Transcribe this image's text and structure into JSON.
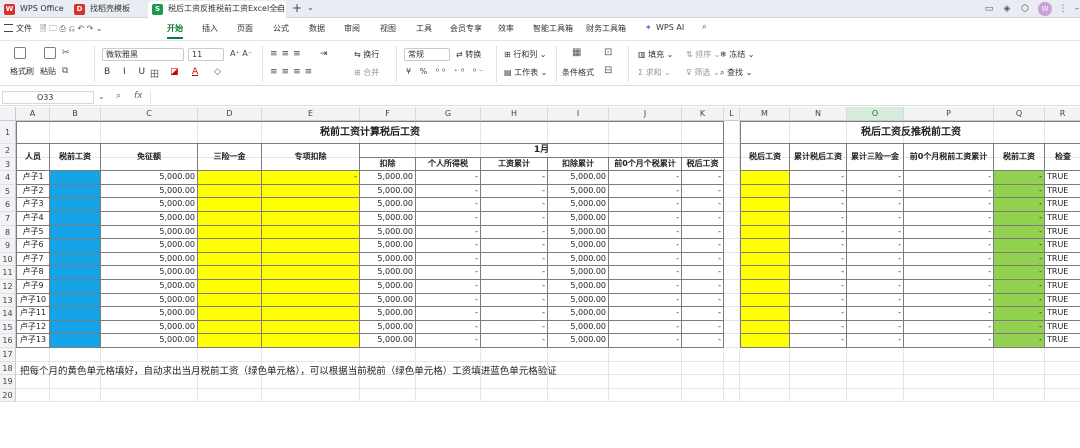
{
  "tabs": [
    {
      "label": "WPS Office",
      "icon": "wps-logo-icon",
      "color": "#d9312b"
    },
    {
      "label": "找稻壳模板",
      "icon": "daoke-template-icon",
      "color": "#d9312b"
    },
    {
      "label": "税后工资反推税前工资Excel全自",
      "icon": "spreadsheet-icon",
      "color": "#1a9b4b"
    }
  ],
  "menus": [
    "文件",
    "开始",
    "插入",
    "页面",
    "公式",
    "数据",
    "审阅",
    "视图",
    "工具",
    "会员专享",
    "效率",
    "智能工具箱",
    "财务工具箱",
    "WPS AI"
  ],
  "active_menu": "开始",
  "toolbar": {
    "format_painter": "格式刷",
    "paste": "粘贴",
    "font_name": "微软雅黑",
    "font_size": "11",
    "wrap": "换行",
    "merge": "合并",
    "number_format": "常规",
    "convert": "转换",
    "row_col": "行和列",
    "worksheet": "工作表",
    "cond_format": "条件格式",
    "fill": "填充",
    "sort": "排序",
    "freeze": "冻结",
    "sum": "求和",
    "filter": "筛选",
    "find": "查找"
  },
  "formula_bar": {
    "name_box": "O33",
    "fx": "fx"
  },
  "columns": [
    "A",
    "B",
    "C",
    "D",
    "E",
    "F",
    "G",
    "H",
    "I",
    "J",
    "K",
    "L",
    "M",
    "N",
    "O",
    "P",
    "Q",
    "R"
  ],
  "rows": [
    "1",
    "2",
    "3",
    "4",
    "5",
    "6",
    "7",
    "8",
    "9",
    "10",
    "11",
    "12",
    "13",
    "14",
    "15",
    "16",
    "17",
    "18",
    "19",
    "20"
  ],
  "sheet": {
    "title_left": "税前工资计算税后工资",
    "title_right": "税后工资反推税前工资",
    "month": "1月",
    "headers_left": {
      "person": "人员",
      "pretax": "税前工资",
      "exempt": "免征额",
      "insurance": "三险一金",
      "special": "专项扣除",
      "deduct": "扣除",
      "tax": "个人所得税",
      "wage_cum": "工资累计",
      "deduct_cum": "扣除累计",
      "prev_tax": "前0个月个税累计",
      "aftertax": "税后工资"
    },
    "headers_right": {
      "aftertax": "税后工资",
      "cum_aftertax": "累计税后工资",
      "cum_ins": "累计三险一金",
      "prev_pretax": "前0个月税前工资累计",
      "pretax": "税前工资",
      "check": "检查"
    },
    "people": [
      "卢子1",
      "卢子2",
      "卢子3",
      "卢子4",
      "卢子5",
      "卢子6",
      "卢子7",
      "卢子8",
      "卢子9",
      "卢子10",
      "卢子11",
      "卢子12",
      "卢子13"
    ],
    "exempt_value": "5,000.00",
    "dash": "-",
    "check_value": "TRUE",
    "note": "把每个月的黄色单元格填好，自动求出当月税前工资（绿色单元格），可以根据当前税前（绿色单元格）工资填进蓝色单元格验证"
  },
  "colors": {
    "blue": "#16a4e8",
    "yellow": "#ffff00",
    "green": "#92d050",
    "accent": "#0f7b3b"
  }
}
